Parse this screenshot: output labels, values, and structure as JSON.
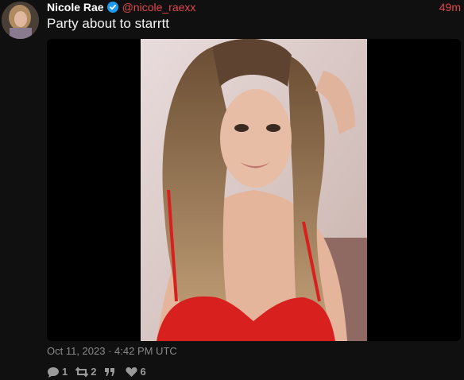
{
  "tweet": {
    "author_name": "Nicole Rae",
    "handle": "@nicole_raexx",
    "relative_time": "49m",
    "text": "Party about to starrtt",
    "date": "Oct 11, 2023 · 4:42 PM UTC"
  },
  "stats": {
    "replies": "1",
    "retweets": "2",
    "quotes": "",
    "likes": "6"
  },
  "colors": {
    "accent": "#e0484c",
    "verified": "#1d9bf0",
    "background": "#101010"
  },
  "icons": [
    "verified-badge-icon",
    "reply-icon",
    "retweet-icon",
    "quote-icon",
    "like-icon"
  ]
}
